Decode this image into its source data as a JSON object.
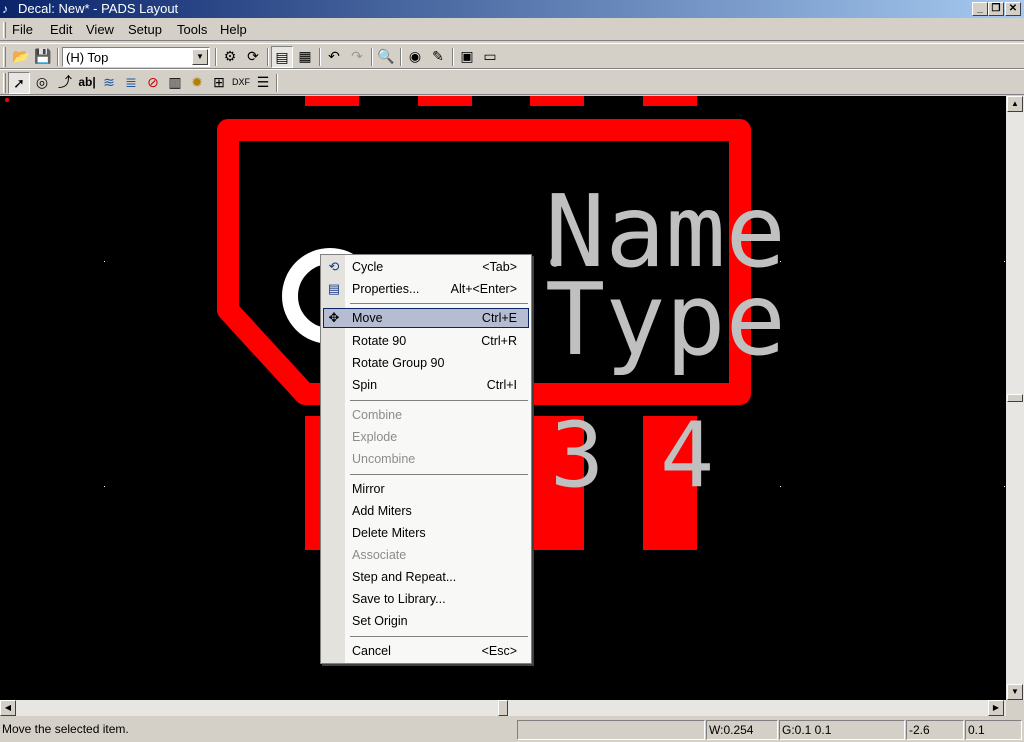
{
  "window": {
    "title": "Decal: New* - PADS Layout",
    "app_icon": "pads-icon"
  },
  "menu": [
    {
      "label": "File"
    },
    {
      "label": "Edit"
    },
    {
      "label": "View"
    },
    {
      "label": "Setup"
    },
    {
      "label": "Tools"
    },
    {
      "label": "Help"
    }
  ],
  "toolbar1": {
    "layer_select": {
      "value": "(H) Top"
    },
    "buttons": [
      "open-icon",
      "save-icon",
      "properties-icon",
      "refresh-icon",
      "layer-toggle-icon",
      "display-colors-icon",
      "undo-icon",
      "redo-icon",
      "zoom-icon",
      "view-icon",
      "brush-icon",
      "library-icon",
      "window-icon"
    ]
  },
  "toolbar2": {
    "buttons": [
      "select-icon",
      "terminal-icon",
      "wizard-icon",
      "text-icon",
      "2d-line-icon",
      "copper-icon",
      "keepout-icon",
      "pad-icon",
      "wizard-star-icon",
      "decal-icon",
      "dxf-icon",
      "list-icon"
    ],
    "text_button_label": "ab|"
  },
  "canvas": {
    "label_name": "Name",
    "label_type": "Type",
    "pin_3": "3",
    "pin_4": "4",
    "colors": {
      "background": "#000000",
      "outline": "#ff0000",
      "text": "#c0c0c0",
      "circle": "#ffffff"
    }
  },
  "context_menu": {
    "items": [
      {
        "label": "Cycle",
        "shortcut": "<Tab>",
        "icon": "cycle-icon"
      },
      {
        "label": "Properties...",
        "shortcut": "Alt+<Enter>",
        "icon": "properties-icon"
      },
      {
        "label": "Move",
        "shortcut": "Ctrl+E",
        "icon": "move-icon",
        "highlighted": true
      },
      {
        "label": "Rotate 90",
        "shortcut": "Ctrl+R"
      },
      {
        "label": "Rotate Group 90",
        "shortcut": ""
      },
      {
        "label": "Spin",
        "shortcut": "Ctrl+I"
      },
      {
        "label": "Combine",
        "shortcut": "",
        "disabled": true
      },
      {
        "label": "Explode",
        "shortcut": "",
        "disabled": true
      },
      {
        "label": "Uncombine",
        "shortcut": "",
        "disabled": true
      },
      {
        "label": "Mirror",
        "shortcut": ""
      },
      {
        "label": "Add Miters",
        "shortcut": ""
      },
      {
        "label": "Delete Miters",
        "shortcut": ""
      },
      {
        "label": "Associate",
        "shortcut": "",
        "disabled": true
      },
      {
        "label": "Step and Repeat...",
        "shortcut": ""
      },
      {
        "label": "Save to Library...",
        "shortcut": ""
      },
      {
        "label": "Set Origin",
        "shortcut": ""
      },
      {
        "label": "Cancel",
        "shortcut": "<Esc>"
      }
    ]
  },
  "status": {
    "message": "Move the selected item.",
    "width": "W:0.254",
    "grid": "G:0.1 0.1",
    "x": "-2.6",
    "y": "0.1"
  }
}
